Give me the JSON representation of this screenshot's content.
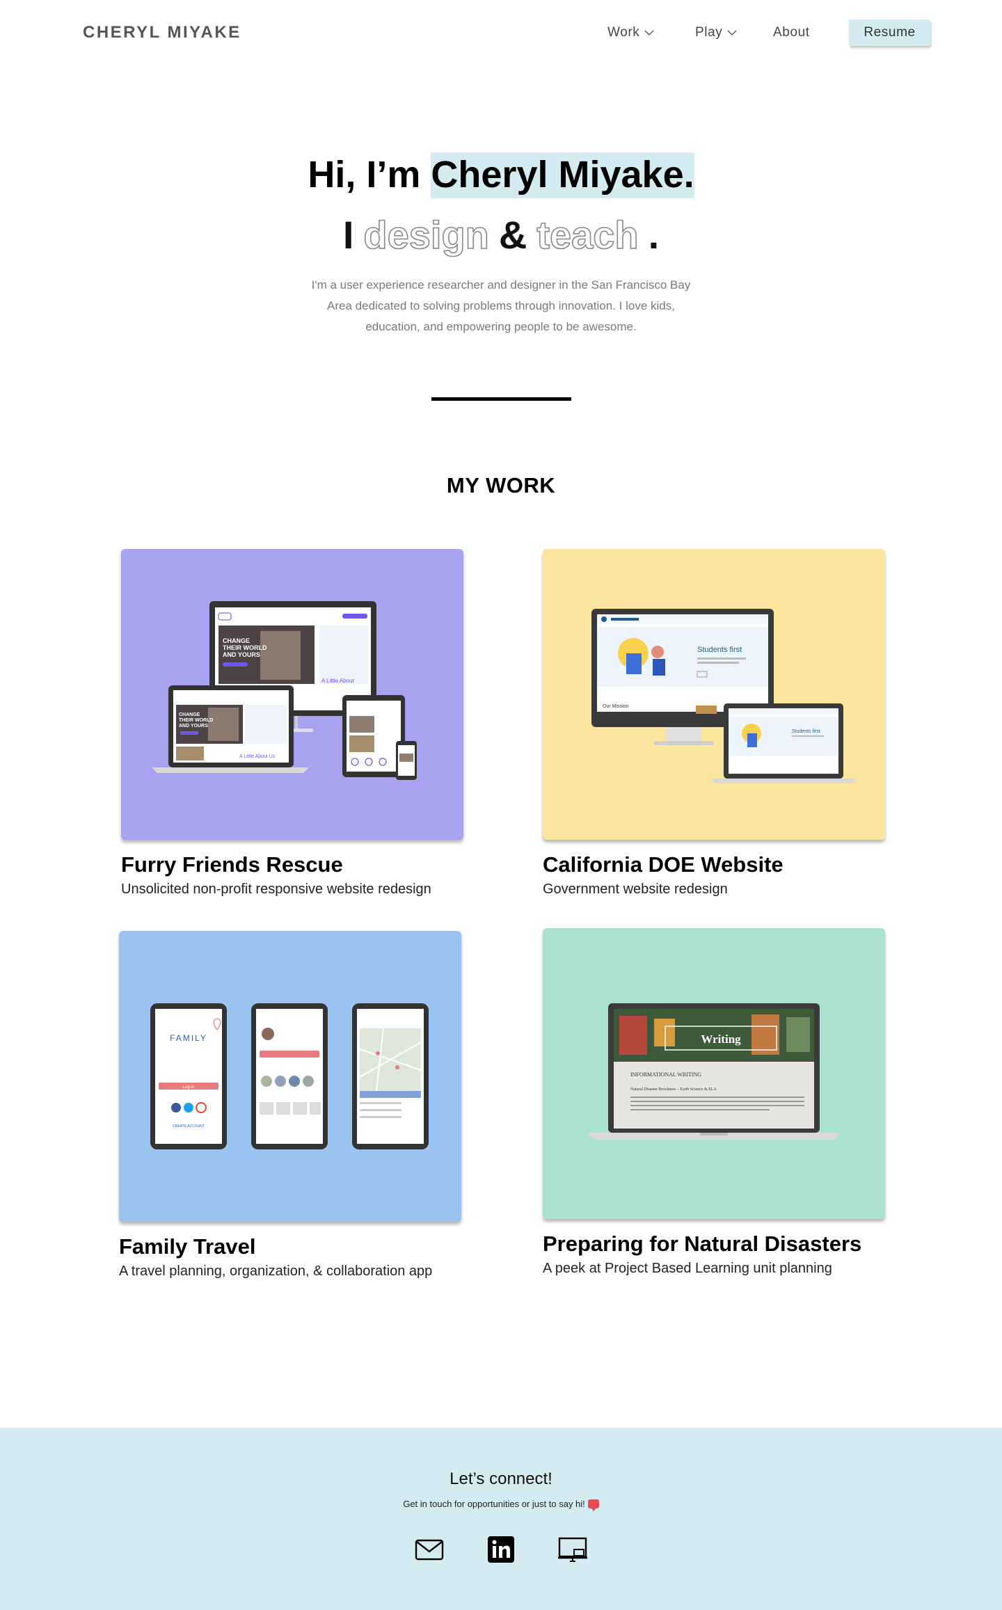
{
  "nav": {
    "brand": "CHERYL MIYAKE",
    "work": "Work",
    "play": "Play",
    "about": "About",
    "resume": "Resume"
  },
  "hero": {
    "greeting": "Hi, I’m ",
    "name": "Cheryl Miyake.",
    "line2_prefix": "I",
    "verb1": "design",
    "amp": "&",
    "verb2": "teach",
    "period": ".",
    "bio": "I'm a user experience researcher and designer in the San Francisco Bay Area dedicated to solving problems through innovation. I love kids, education, and empowering people to be awesome."
  },
  "work": {
    "title": "MY WORK",
    "projects": [
      {
        "title": "Furry Friends Rescue",
        "description": "Unsolicited non-profit responsive website redesign",
        "bg": "#a7a3f1",
        "mockup_texts": [
          "CHANGE THEIR WORLD AND YOURS",
          "A Little About Us"
        ]
      },
      {
        "title": "California DOE Website",
        "description": "Government website redesign",
        "bg": "#fbe49b",
        "mockup_texts": [
          "Students first",
          "Our Mission"
        ]
      },
      {
        "title": "Family Travel",
        "description": "A travel planning, organization, & collaboration app",
        "bg": "#9ac3f0",
        "mockup_texts": [
          "FAMILY",
          "Log in",
          "CREATE ACCOUNT"
        ]
      },
      {
        "title": "Preparing for Natural Disasters",
        "description": "A peek at Project Based Learning unit planning",
        "bg": "#a9e3cd",
        "mockup_texts": [
          "Writing",
          "INFORMATIONAL WRITING",
          "Natural Disaster Brochures – Earth Science & ELA"
        ]
      }
    ]
  },
  "footer": {
    "title": "Let’s connect!",
    "subtitle": "Get in touch for opportunities or just to say hi!",
    "icons": [
      "mail-icon",
      "linkedin-icon",
      "slideshow-icon"
    ]
  },
  "colors": {
    "accent": "#d4ebf1",
    "footer_bg": "#d4ebf1"
  }
}
